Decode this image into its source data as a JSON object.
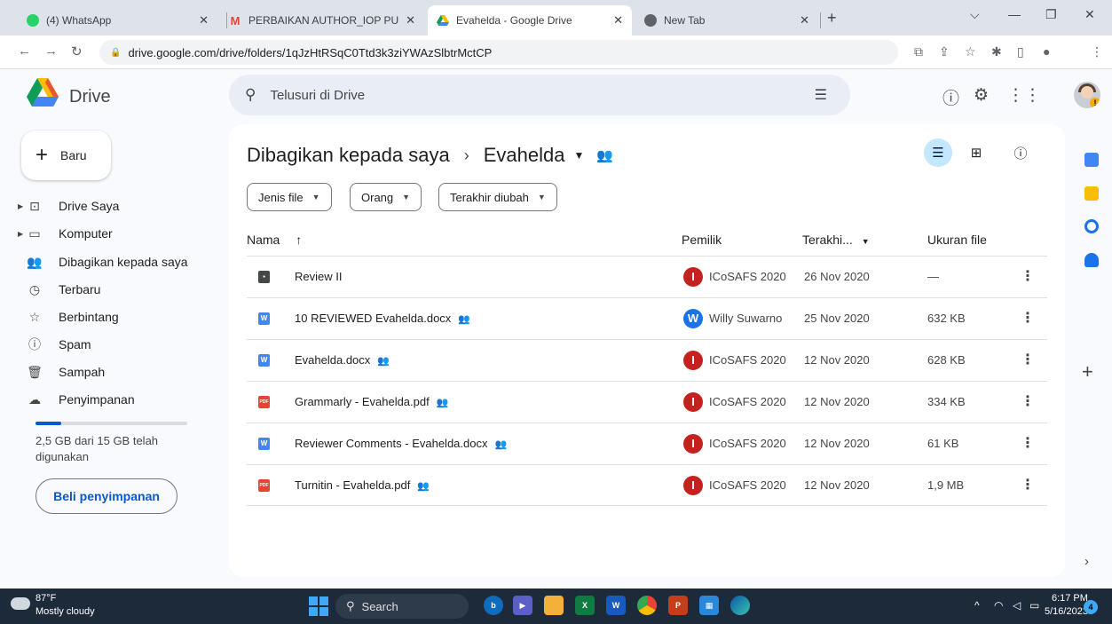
{
  "browser": {
    "tabs": [
      {
        "title": "(4) WhatsApp",
        "icon": "whatsapp-icon",
        "color": "#25d366"
      },
      {
        "title": "PERBAIKAN AUTHOR_IOP PUBLIS",
        "icon": "gmail-icon",
        "color": "#ea4335"
      },
      {
        "title": "Evahelda - Google Drive",
        "icon": "google-drive-icon",
        "color": "#1a73e8"
      },
      {
        "title": "New Tab",
        "icon": "chrome-icon",
        "color": "#5f6368"
      }
    ],
    "url": "drive.google.com/drive/folders/1qJzHtRSqC0Ttd3k3ziYWAzSlbtrMctCP"
  },
  "header": {
    "app_name": "Drive",
    "search_placeholder": "Telusuri di Drive"
  },
  "sidebar": {
    "new_label": "Baru",
    "items": [
      {
        "label": "Drive Saya",
        "icon": "my-drive-icon",
        "glyph": "⊡",
        "caret": true
      },
      {
        "label": "Komputer",
        "icon": "computer-icon",
        "glyph": "▭",
        "caret": true
      },
      {
        "label": "Dibagikan kepada saya",
        "icon": "shared-people-icon",
        "glyph": "👥",
        "caret": false
      },
      {
        "label": "Terbaru",
        "icon": "clock-icon",
        "glyph": "◷",
        "caret": false
      },
      {
        "label": "Berbintang",
        "icon": "star-icon",
        "glyph": "☆",
        "caret": false
      },
      {
        "label": "Spam",
        "icon": "spam-icon",
        "glyph": "ⓘ",
        "caret": false
      },
      {
        "label": "Sampah",
        "icon": "trash-icon",
        "glyph": "🗑",
        "caret": false
      },
      {
        "label": "Penyimpanan",
        "icon": "cloud-icon",
        "glyph": "☁",
        "caret": false
      }
    ],
    "storage_used_fraction": 0.17,
    "storage_text": "2,5 GB dari 15 GB telah digunakan",
    "buy_label": "Beli penyimpanan"
  },
  "main": {
    "breadcrumb_root": "Dibagikan kepada saya",
    "breadcrumb_current": "Evahelda",
    "filters": [
      "Jenis file",
      "Orang",
      "Terakhir diubah"
    ],
    "columns": {
      "name": "Nama",
      "owner": "Pemilik",
      "modified": "Terakhi...",
      "size": "Ukuran file"
    },
    "files": [
      {
        "name": "Review II",
        "type": "folder",
        "shared": false,
        "owner": "ICoSAFS 2020",
        "owner_initial": "I",
        "owner_color": "#c5221f",
        "modified": "26 Nov 2020",
        "size": "—"
      },
      {
        "name": "10 REVIEWED Evahelda.docx",
        "type": "docx",
        "shared": true,
        "owner": "Willy Suwarno",
        "owner_initial": "W",
        "owner_color": "#1a73e8",
        "modified": "25 Nov 2020",
        "size": "632 KB"
      },
      {
        "name": "Evahelda.docx",
        "type": "docx",
        "shared": true,
        "owner": "ICoSAFS 2020",
        "owner_initial": "I",
        "owner_color": "#c5221f",
        "modified": "12 Nov 2020",
        "size": "628 KB"
      },
      {
        "name": "Grammarly - Evahelda.pdf",
        "type": "pdf",
        "shared": true,
        "owner": "ICoSAFS 2020",
        "owner_initial": "I",
        "owner_color": "#c5221f",
        "modified": "12 Nov 2020",
        "size": "334 KB"
      },
      {
        "name": "Reviewer Comments - Evahelda.docx",
        "type": "docx",
        "shared": true,
        "owner": "ICoSAFS 2020",
        "owner_initial": "I",
        "owner_color": "#c5221f",
        "modified": "12 Nov 2020",
        "size": "61 KB"
      },
      {
        "name": "Turnitin - Evahelda.pdf",
        "type": "pdf",
        "shared": true,
        "owner": "ICoSAFS 2020",
        "owner_initial": "I",
        "owner_color": "#c5221f",
        "modified": "12 Nov 2020",
        "size": "1,9 MB"
      }
    ]
  },
  "taskbar": {
    "temperature": "87°F",
    "weather": "Mostly cloudy",
    "search_label": "Search",
    "time": "6:17 PM",
    "date": "5/16/2023",
    "notification_count": "4"
  }
}
